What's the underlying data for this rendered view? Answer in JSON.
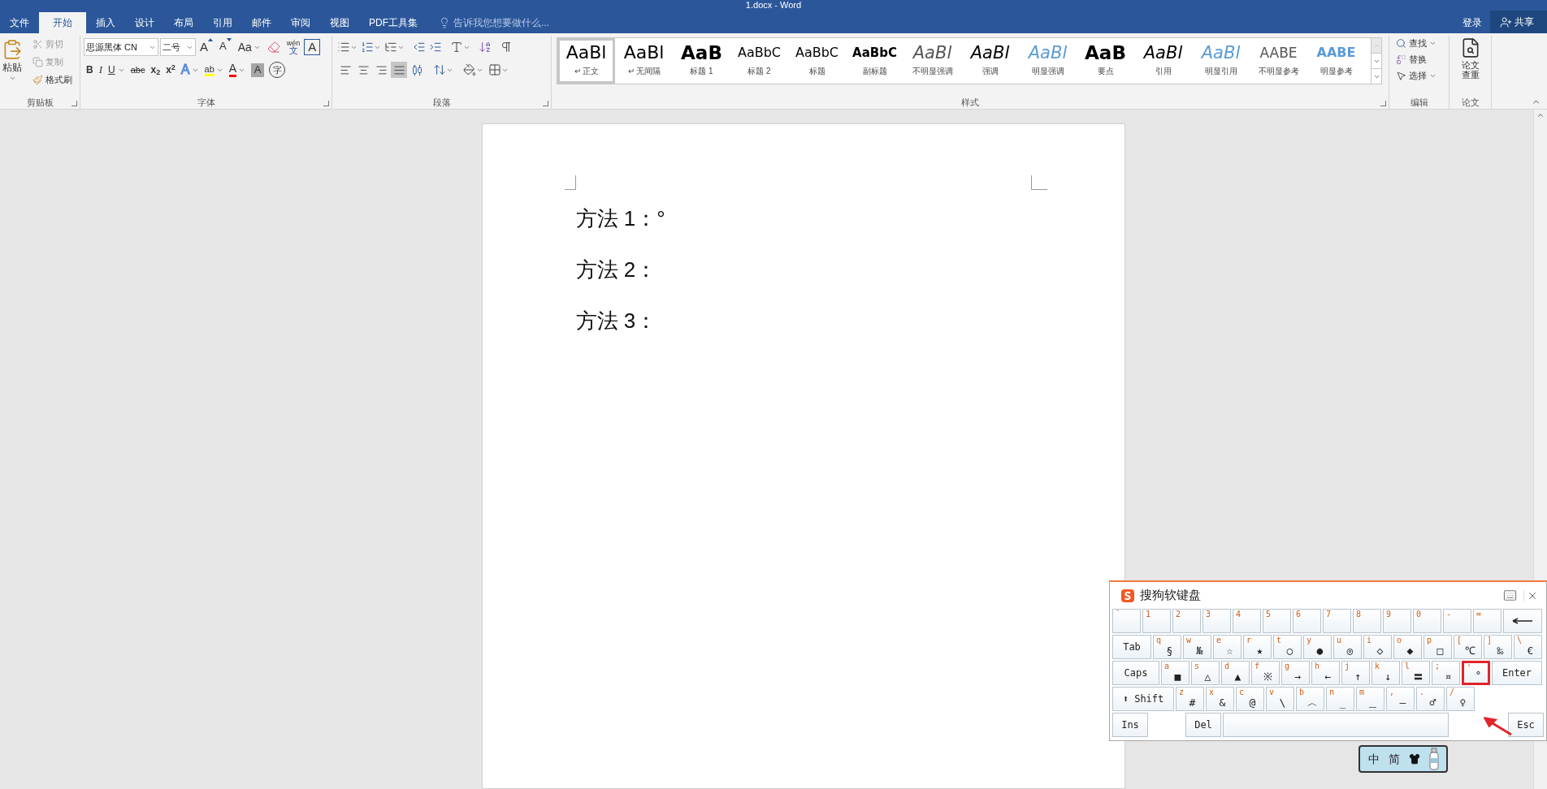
{
  "window": {
    "title": "1.docx - Word"
  },
  "tabs": [
    {
      "label": "文件",
      "selected": false
    },
    {
      "label": "开始",
      "selected": true
    },
    {
      "label": "插入",
      "selected": false
    },
    {
      "label": "设计",
      "selected": false
    },
    {
      "label": "布局",
      "selected": false
    },
    {
      "label": "引用",
      "selected": false
    },
    {
      "label": "邮件",
      "selected": false
    },
    {
      "label": "审阅",
      "selected": false
    },
    {
      "label": "视图",
      "selected": false
    },
    {
      "label": "PDF工具集",
      "selected": false
    }
  ],
  "tell_me": {
    "placeholder": "告诉我您想要做什么..."
  },
  "account": {
    "sign_in": "登录",
    "share": "共享"
  },
  "clipboard": {
    "paste": "粘贴",
    "cut": "剪切",
    "copy": "复制",
    "format_painter": "格式刷",
    "label": "剪贴板"
  },
  "font": {
    "name": "思源黑体 CN",
    "size": "二号",
    "label": "字体",
    "row1": [
      {
        "kind": "grow",
        "label": "A"
      },
      {
        "kind": "shrink",
        "label": "A"
      },
      {
        "kind": "case",
        "label": "Aa"
      },
      {
        "kind": "clear"
      },
      {
        "kind": "phonetic",
        "label": "文",
        "ruby": "wén"
      },
      {
        "kind": "border",
        "label": "A"
      }
    ],
    "row2": [
      {
        "kind": "bold",
        "label": "B"
      },
      {
        "kind": "italic",
        "label": "I"
      },
      {
        "kind": "underline",
        "label": "U"
      },
      {
        "kind": "strike",
        "label": "abc"
      },
      {
        "kind": "sub",
        "label": "x$_{2}$"
      },
      {
        "kind": "sup",
        "label": "x$^{2}$"
      },
      {
        "kind": "effect",
        "label": "A"
      },
      {
        "kind": "highlight",
        "label": "ab"
      },
      {
        "kind": "color",
        "label": "A"
      },
      {
        "kind": "shade",
        "label": "A"
      },
      {
        "kind": "enclose",
        "label": "字"
      }
    ]
  },
  "paragraph": {
    "label": "段落",
    "align": [
      {
        "kind": "left",
        "selected": false
      },
      {
        "kind": "center",
        "selected": false
      },
      {
        "kind": "right",
        "selected": false
      },
      {
        "kind": "justify",
        "selected": true
      },
      {
        "kind": "distributed",
        "selected": false
      }
    ]
  },
  "styles": {
    "label": "样式",
    "items": [
      {
        "preview": "AaBl",
        "name": "正文",
        "mark": "↵",
        "kind": "normal",
        "selected": true
      },
      {
        "preview": "AaBl",
        "name": "无间隔",
        "mark": "↵",
        "kind": "normal",
        "selected": false
      },
      {
        "preview": "AaB",
        "name": "标题 1",
        "kind": "heading1",
        "selected": false
      },
      {
        "preview": "AaBbC",
        "name": "标题 2",
        "kind": "heading2",
        "selected": false
      },
      {
        "preview": "AaBbC",
        "name": "标题",
        "kind": "heading2",
        "selected": false
      },
      {
        "preview": "AaBbC",
        "name": "副标题",
        "kind": "subtitle",
        "selected": false
      },
      {
        "preview": "AaBl",
        "name": "不明显强调",
        "kind": "subtle",
        "selected": false
      },
      {
        "preview": "AaBl",
        "name": "强调",
        "kind": "emphasis",
        "selected": false
      },
      {
        "preview": "AaBl",
        "name": "明显强调",
        "kind": "intense",
        "selected": false
      },
      {
        "preview": "AaB",
        "name": "要点",
        "kind": "heading1",
        "selected": false
      },
      {
        "preview": "AaBl",
        "name": "引用",
        "kind": "emphasis",
        "selected": false
      },
      {
        "preview": "AaBl",
        "name": "明显引用",
        "kind": "intense",
        "selected": false
      },
      {
        "preview": "AABE",
        "name": "不明显参考",
        "kind": "subtleref",
        "selected": false
      },
      {
        "preview": "AABE",
        "name": "明显参考",
        "kind": "intenseref",
        "selected": false
      }
    ]
  },
  "editing": {
    "find": "查找",
    "replace": "替换",
    "select": "选择",
    "label": "编辑"
  },
  "thesis": {
    "button": [
      "论文",
      "查重"
    ],
    "label": "论文"
  },
  "document": {
    "lines": [
      "方法 1：°",
      "方法 2：",
      "方法 3："
    ]
  },
  "soft_keyboard": {
    "title": "搜狗软键盘",
    "rows": [
      {
        "keys": [
          {
            "kind": "char",
            "key": "`",
            "marked": false
          },
          {
            "kind": "char",
            "key": "1",
            "marked": false
          },
          {
            "kind": "char",
            "key": "2",
            "marked": false
          },
          {
            "kind": "char",
            "key": "3",
            "marked": false
          },
          {
            "kind": "char",
            "key": "4",
            "marked": false
          },
          {
            "kind": "char",
            "key": "5",
            "marked": false
          },
          {
            "kind": "char",
            "key": "6",
            "marked": false
          },
          {
            "kind": "char",
            "key": "7",
            "marked": false
          },
          {
            "kind": "char",
            "key": "8",
            "marked": false
          },
          {
            "kind": "char",
            "key": "9",
            "marked": false
          },
          {
            "kind": "char",
            "key": "0",
            "marked": false
          },
          {
            "kind": "char",
            "key": "-",
            "marked": false
          },
          {
            "kind": "char",
            "key": "=",
            "marked": false
          },
          {
            "kind": "backspace",
            "marked": false
          }
        ]
      },
      {
        "keys": [
          {
            "kind": "special",
            "label": "Tab",
            "marked": false
          },
          {
            "kind": "char",
            "key": "q",
            "symbol": "§",
            "marked": false
          },
          {
            "kind": "char",
            "key": "w",
            "symbol": "№",
            "marked": false
          },
          {
            "kind": "char",
            "key": "e",
            "symbol": "☆",
            "marked": false
          },
          {
            "kind": "char",
            "key": "r",
            "symbol": "★",
            "marked": false
          },
          {
            "kind": "char",
            "key": "t",
            "symbol": "○",
            "marked": false
          },
          {
            "kind": "char",
            "key": "y",
            "symbol": "●",
            "marked": false
          },
          {
            "kind": "char",
            "key": "u",
            "symbol": "◎",
            "marked": false
          },
          {
            "kind": "char",
            "key": "i",
            "symbol": "◇",
            "marked": false
          },
          {
            "kind": "char",
            "key": "o",
            "symbol": "◆",
            "marked": false
          },
          {
            "kind": "char",
            "key": "p",
            "symbol": "□",
            "marked": false
          },
          {
            "kind": "char",
            "key": "[",
            "symbol": "℃",
            "marked": false
          },
          {
            "kind": "char",
            "key": "]",
            "symbol": "‰",
            "marked": false
          },
          {
            "kind": "char",
            "key": "\\",
            "symbol": "€",
            "marked": false
          }
        ]
      },
      {
        "keys": [
          {
            "kind": "special",
            "label": "Caps",
            "marked": false
          },
          {
            "kind": "char",
            "key": "a",
            "symbol": "■",
            "marked": false
          },
          {
            "kind": "char",
            "key": "s",
            "symbol": "△",
            "marked": false
          },
          {
            "kind": "char",
            "key": "d",
            "symbol": "▲",
            "marked": false
          },
          {
            "kind": "char",
            "key": "f",
            "symbol": "※",
            "marked": false
          },
          {
            "kind": "char",
            "key": "g",
            "symbol": "→",
            "marked": false
          },
          {
            "kind": "char",
            "key": "h",
            "symbol": "←",
            "marked": false
          },
          {
            "kind": "char",
            "key": "j",
            "symbol": "↑",
            "marked": false
          },
          {
            "kind": "char",
            "key": "k",
            "symbol": "↓",
            "marked": false
          },
          {
            "kind": "char",
            "key": "l",
            "symbol": "〓",
            "marked": false
          },
          {
            "kind": "char",
            "key": ";",
            "symbol": "¤",
            "marked": false
          },
          {
            "kind": "char",
            "key": "'",
            "symbol": "°",
            "marked": true
          },
          {
            "kind": "special",
            "label": "Enter",
            "marked": false
          }
        ]
      },
      {
        "keys": [
          {
            "kind": "special",
            "label": "⬆ Shift",
            "marked": false
          },
          {
            "kind": "char",
            "key": "z",
            "symbol": "#",
            "marked": false
          },
          {
            "kind": "char",
            "key": "x",
            "symbol": "&",
            "marked": false
          },
          {
            "kind": "char",
            "key": "c",
            "symbol": "@",
            "marked": false
          },
          {
            "kind": "char",
            "key": "v",
            "symbol": "\\",
            "marked": false
          },
          {
            "kind": "char",
            "key": "b",
            "symbol": "︿",
            "marked": false
          },
          {
            "kind": "char",
            "key": "n",
            "symbol": "_",
            "marked": false
          },
          {
            "kind": "char",
            "key": "m",
            "symbol": "＿",
            "marked": false
          },
          {
            "kind": "char",
            "key": ",",
            "symbol": "—",
            "marked": false
          },
          {
            "kind": "char",
            "key": ".",
            "symbol": "♂",
            "marked": false
          },
          {
            "kind": "char",
            "key": "/",
            "symbol": "♀",
            "marked": false
          }
        ]
      },
      {
        "keys": [
          {
            "kind": "special",
            "label": "Ins",
            "marked": false
          },
          {
            "kind": "special",
            "label": "Del",
            "marked": false
          },
          {
            "kind": "space",
            "marked": false
          },
          {
            "kind": "special",
            "label": "Esc",
            "marked": false
          }
        ]
      }
    ]
  },
  "ime_bar": {
    "mode": "中",
    "script": "简"
  }
}
